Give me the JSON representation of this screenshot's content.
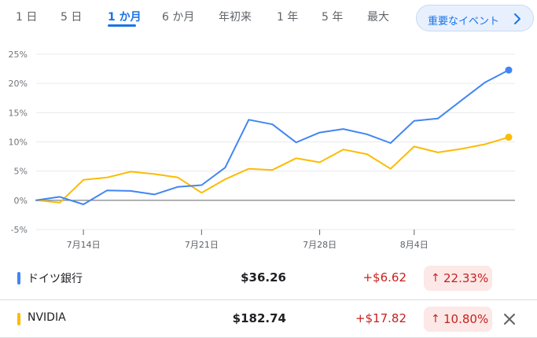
{
  "ranges": {
    "items": [
      "1 日",
      "5 日",
      "1 か月",
      "6 か月",
      "年初来",
      "1 年",
      "5 年",
      "最大"
    ],
    "active": "1 か月"
  },
  "events_button": {
    "label": "重要なイベント",
    "icon": "chevron-right-icon"
  },
  "colors": {
    "accent": "#1a73e8",
    "series1": "#4285f4",
    "series2": "#fbbc04",
    "negative": "#c5221f",
    "negative_bg": "#fce8e6"
  },
  "chart_data": {
    "type": "line",
    "y_ticks": [
      "25%",
      "20%",
      "15%",
      "10%",
      "5%",
      "0%",
      "-5%"
    ],
    "ylim": [
      -5,
      25
    ],
    "x_tick_labels": [
      "7月14日",
      "7月21日",
      "7月28日",
      "8月4日"
    ],
    "x_tick_index": [
      2,
      7,
      12,
      16
    ],
    "grid": true,
    "series": [
      {
        "name": "ドイツ銀行",
        "color": "#4285f4",
        "values": [
          0,
          0.6,
          -0.7,
          1.7,
          1.6,
          1.0,
          2.3,
          2.6,
          5.6,
          13.8,
          13.0,
          9.9,
          11.6,
          12.2,
          11.3,
          9.8,
          13.6,
          14.0,
          17.1,
          20.2,
          22.3
        ]
      },
      {
        "name": "NVIDIA",
        "color": "#fbbc04",
        "values": [
          0,
          -0.4,
          3.5,
          3.9,
          4.9,
          4.5,
          3.9,
          1.3,
          3.6,
          5.4,
          5.2,
          7.2,
          6.5,
          8.7,
          7.9,
          5.4,
          9.2,
          8.2,
          8.8,
          9.6,
          10.8
        ]
      }
    ]
  },
  "holdings": [
    {
      "name": "ドイツ銀行",
      "color": "#4285f4",
      "price": "$36.26",
      "change": "+$6.62",
      "pct": "22.33%"
    },
    {
      "name": "NVIDIA",
      "color": "#fbbc04",
      "price": "$182.74",
      "change": "+$17.82",
      "pct": "10.80%",
      "removable": true
    }
  ],
  "up_arrow": "↑"
}
